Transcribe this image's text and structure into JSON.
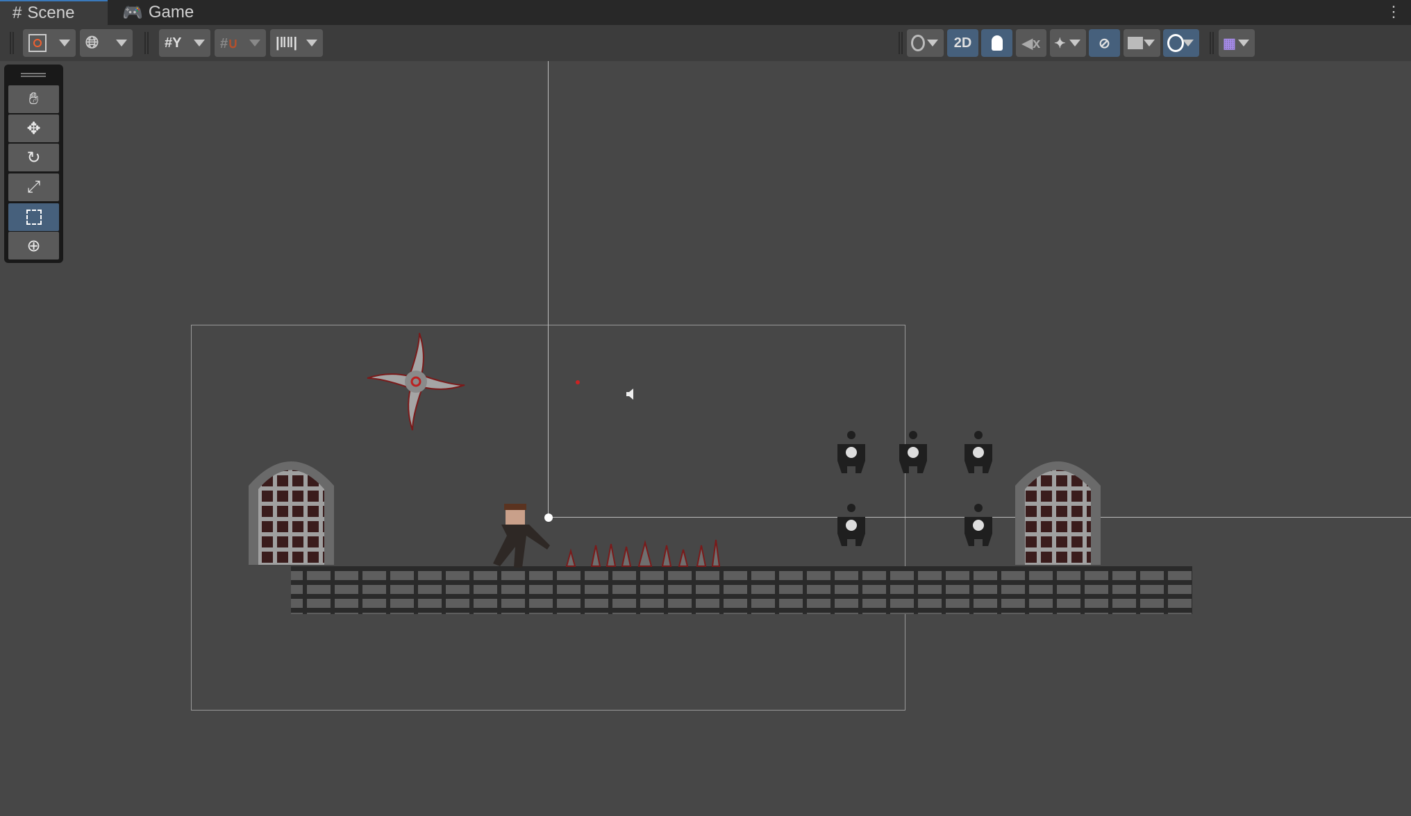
{
  "tabs": [
    {
      "label": "Scene",
      "icon": "grid-icon",
      "active": true
    },
    {
      "label": "Game",
      "icon": "gamepad-icon",
      "active": false
    }
  ],
  "toolbar": {
    "mode_2d_label": "2D",
    "accent": "#46607c"
  },
  "tools": [
    "hand",
    "move",
    "rotate",
    "scale",
    "rect",
    "transform"
  ],
  "active_tool": "rect"
}
